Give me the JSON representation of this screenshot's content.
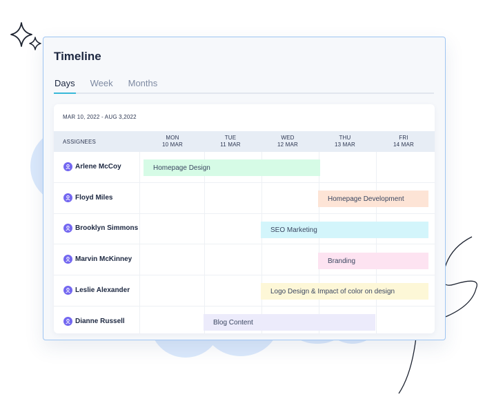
{
  "header": {
    "title": "Timeline"
  },
  "tabs": [
    {
      "label": "Days",
      "active": true
    },
    {
      "label": "Week",
      "active": false
    },
    {
      "label": "Months",
      "active": false
    }
  ],
  "timeline": {
    "range": "MAR 10, 2022 - AUG 3,2022",
    "assignees_header": "ASSIGNEES",
    "days": [
      {
        "weekday": "MON",
        "date": "10 MAR"
      },
      {
        "weekday": "TUE",
        "date": "11 MAR"
      },
      {
        "weekday": "WED",
        "date": "12 MAR"
      },
      {
        "weekday": "THU",
        "date": "13 MAR"
      },
      {
        "weekday": "FRI",
        "date": "14 MAR"
      }
    ],
    "assignees": [
      {
        "name": "Arlene McCoy"
      },
      {
        "name": "Floyd Miles"
      },
      {
        "name": "Brooklyn Simmons"
      },
      {
        "name": "Marvin McKinney"
      },
      {
        "name": "Leslie Alexander"
      },
      {
        "name": "Dianne Russell"
      }
    ],
    "tasks": [
      {
        "label": "Homepage Design",
        "color": "#d6fbe6"
      },
      {
        "label": "Homepage Development",
        "color": "#fde4d6"
      },
      {
        "label": "SEO Marketing",
        "color": "#d3f5fb"
      },
      {
        "label": "Branding",
        "color": "#fde3f1"
      },
      {
        "label": "Logo Design & Impact of color on design",
        "color": "#fdf7d7"
      },
      {
        "label": "Blog Content",
        "color": "#ecebfb"
      }
    ]
  },
  "icons": {
    "avatar": "user-icon",
    "sparkle": "sparkle-icon"
  },
  "colors": {
    "accent": "#38b8d8",
    "avatar": "#7367f0",
    "border": "#9ec5f2"
  }
}
